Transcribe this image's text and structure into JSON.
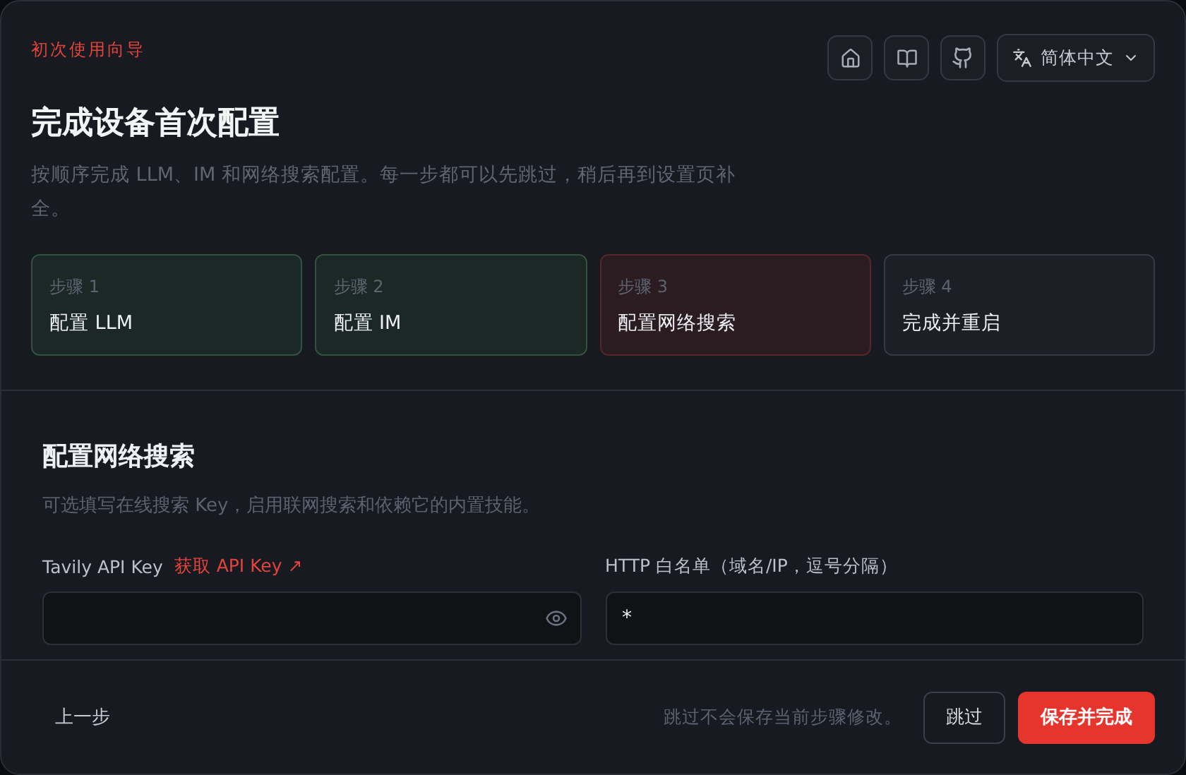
{
  "header": {
    "eyebrow": "初次使用向导",
    "title": "完成设备首次配置",
    "description": "按顺序完成 LLM、IM 和网络搜索配置。每一步都可以先跳过，稍后再到设置页补全。",
    "language": "简体中文"
  },
  "steps": [
    {
      "label": "步骤 1",
      "title": "配置 LLM",
      "kind": "done"
    },
    {
      "label": "步骤 2",
      "title": "配置 IM",
      "kind": "done"
    },
    {
      "label": "步骤 3",
      "title": "配置网络搜索",
      "kind": "current"
    },
    {
      "label": "步骤 4",
      "title": "完成并重启",
      "kind": "pending"
    }
  ],
  "section": {
    "title": "配置网络搜索",
    "description": "可选填写在线搜索 Key，启用联网搜索和依赖它的内置技能。",
    "fields": [
      {
        "label": "Tavily API Key",
        "link": "获取 API Key ↗",
        "kind": "secret"
      },
      {
        "label": "HTTP 白名单（域名/IP，逗号分隔）",
        "value": "*",
        "kind": "text"
      }
    ]
  },
  "footer": {
    "back": "上一步",
    "hint": "跳过不会保存当前步骤修改。",
    "skip": "跳过",
    "primary": "保存并完成"
  }
}
